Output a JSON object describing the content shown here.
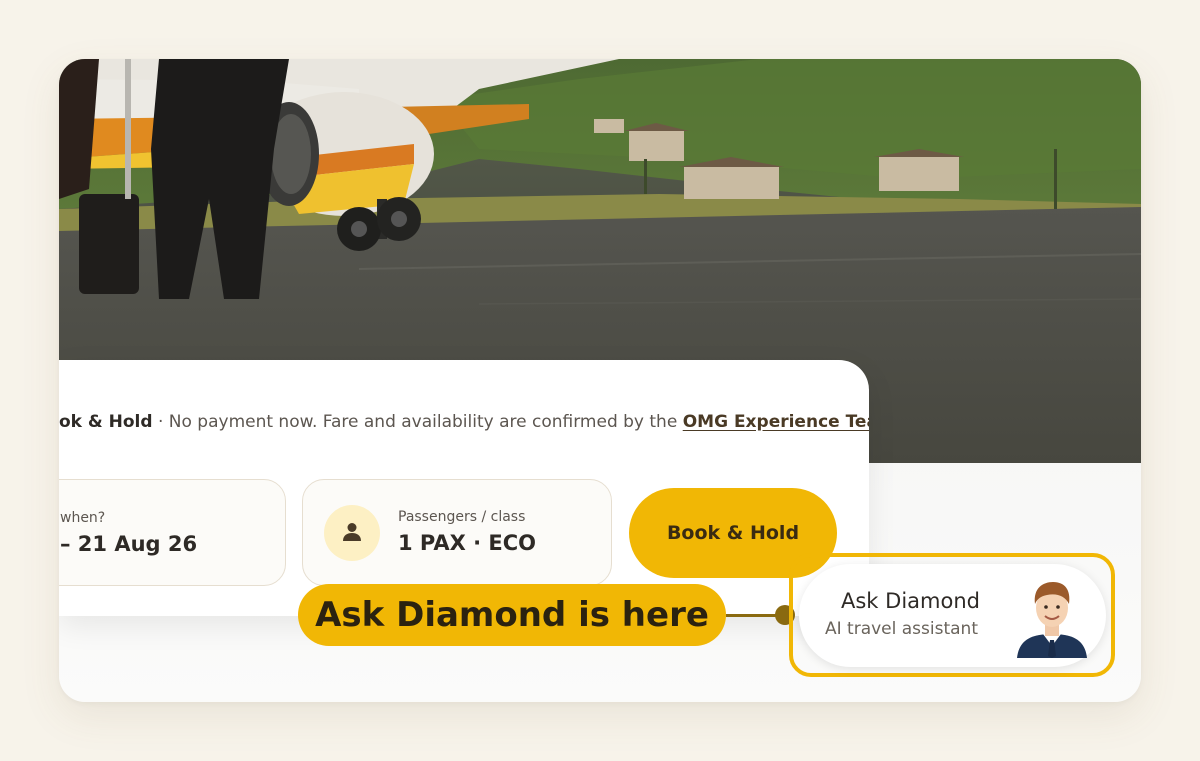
{
  "hold_notice": {
    "lead": "ok & Hold",
    "separator": " · ",
    "text": "No payment now. Fare and availability are confirmed by the ",
    "link": "OMG Experience Team",
    "end": "."
  },
  "search": {
    "when_label": "when?",
    "when_value": "– 21 Aug 26",
    "pax_label": "Passengers / class",
    "pax_value": "1 PAX · ECO",
    "pax_icon": "person-icon"
  },
  "book_button": {
    "label": "Book & Hold"
  },
  "callout": {
    "text": "Ask Diamond is here"
  },
  "assistant": {
    "name": "Ask Diamond",
    "subtitle": "AI travel assistant",
    "avatar": "assistant-avatar"
  },
  "colors": {
    "accent": "#f1b705",
    "accent_dark": "#8a6a10",
    "page_bg": "#f7f3ea",
    "text_dark": "#2e2a26"
  }
}
